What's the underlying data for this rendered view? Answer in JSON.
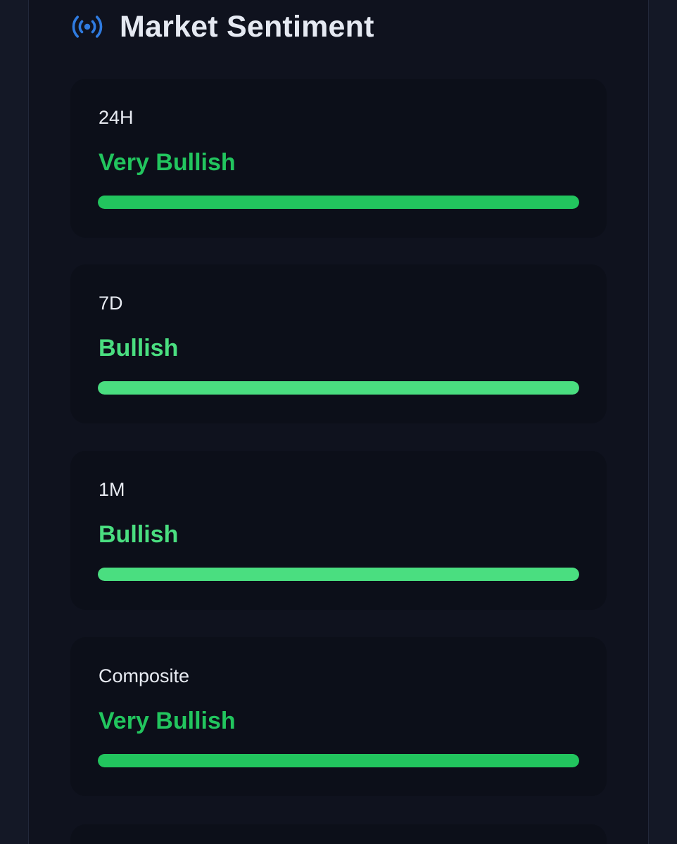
{
  "header": {
    "title": "Market Sentiment",
    "icon": "broadcast-icon",
    "icon_color": "#2f7be0"
  },
  "sentiments": [
    {
      "period": "24H",
      "label": "Very Bullish",
      "color": "#22c55e",
      "level": 1.0
    },
    {
      "period": "7D",
      "label": "Bullish",
      "color": "#4ade80",
      "level": 1.0
    },
    {
      "period": "1M",
      "label": "Bullish",
      "color": "#4ade80",
      "level": 1.0
    },
    {
      "period": "Composite",
      "label": "Very Bullish",
      "color": "#22c55e",
      "level": 1.0
    }
  ]
}
